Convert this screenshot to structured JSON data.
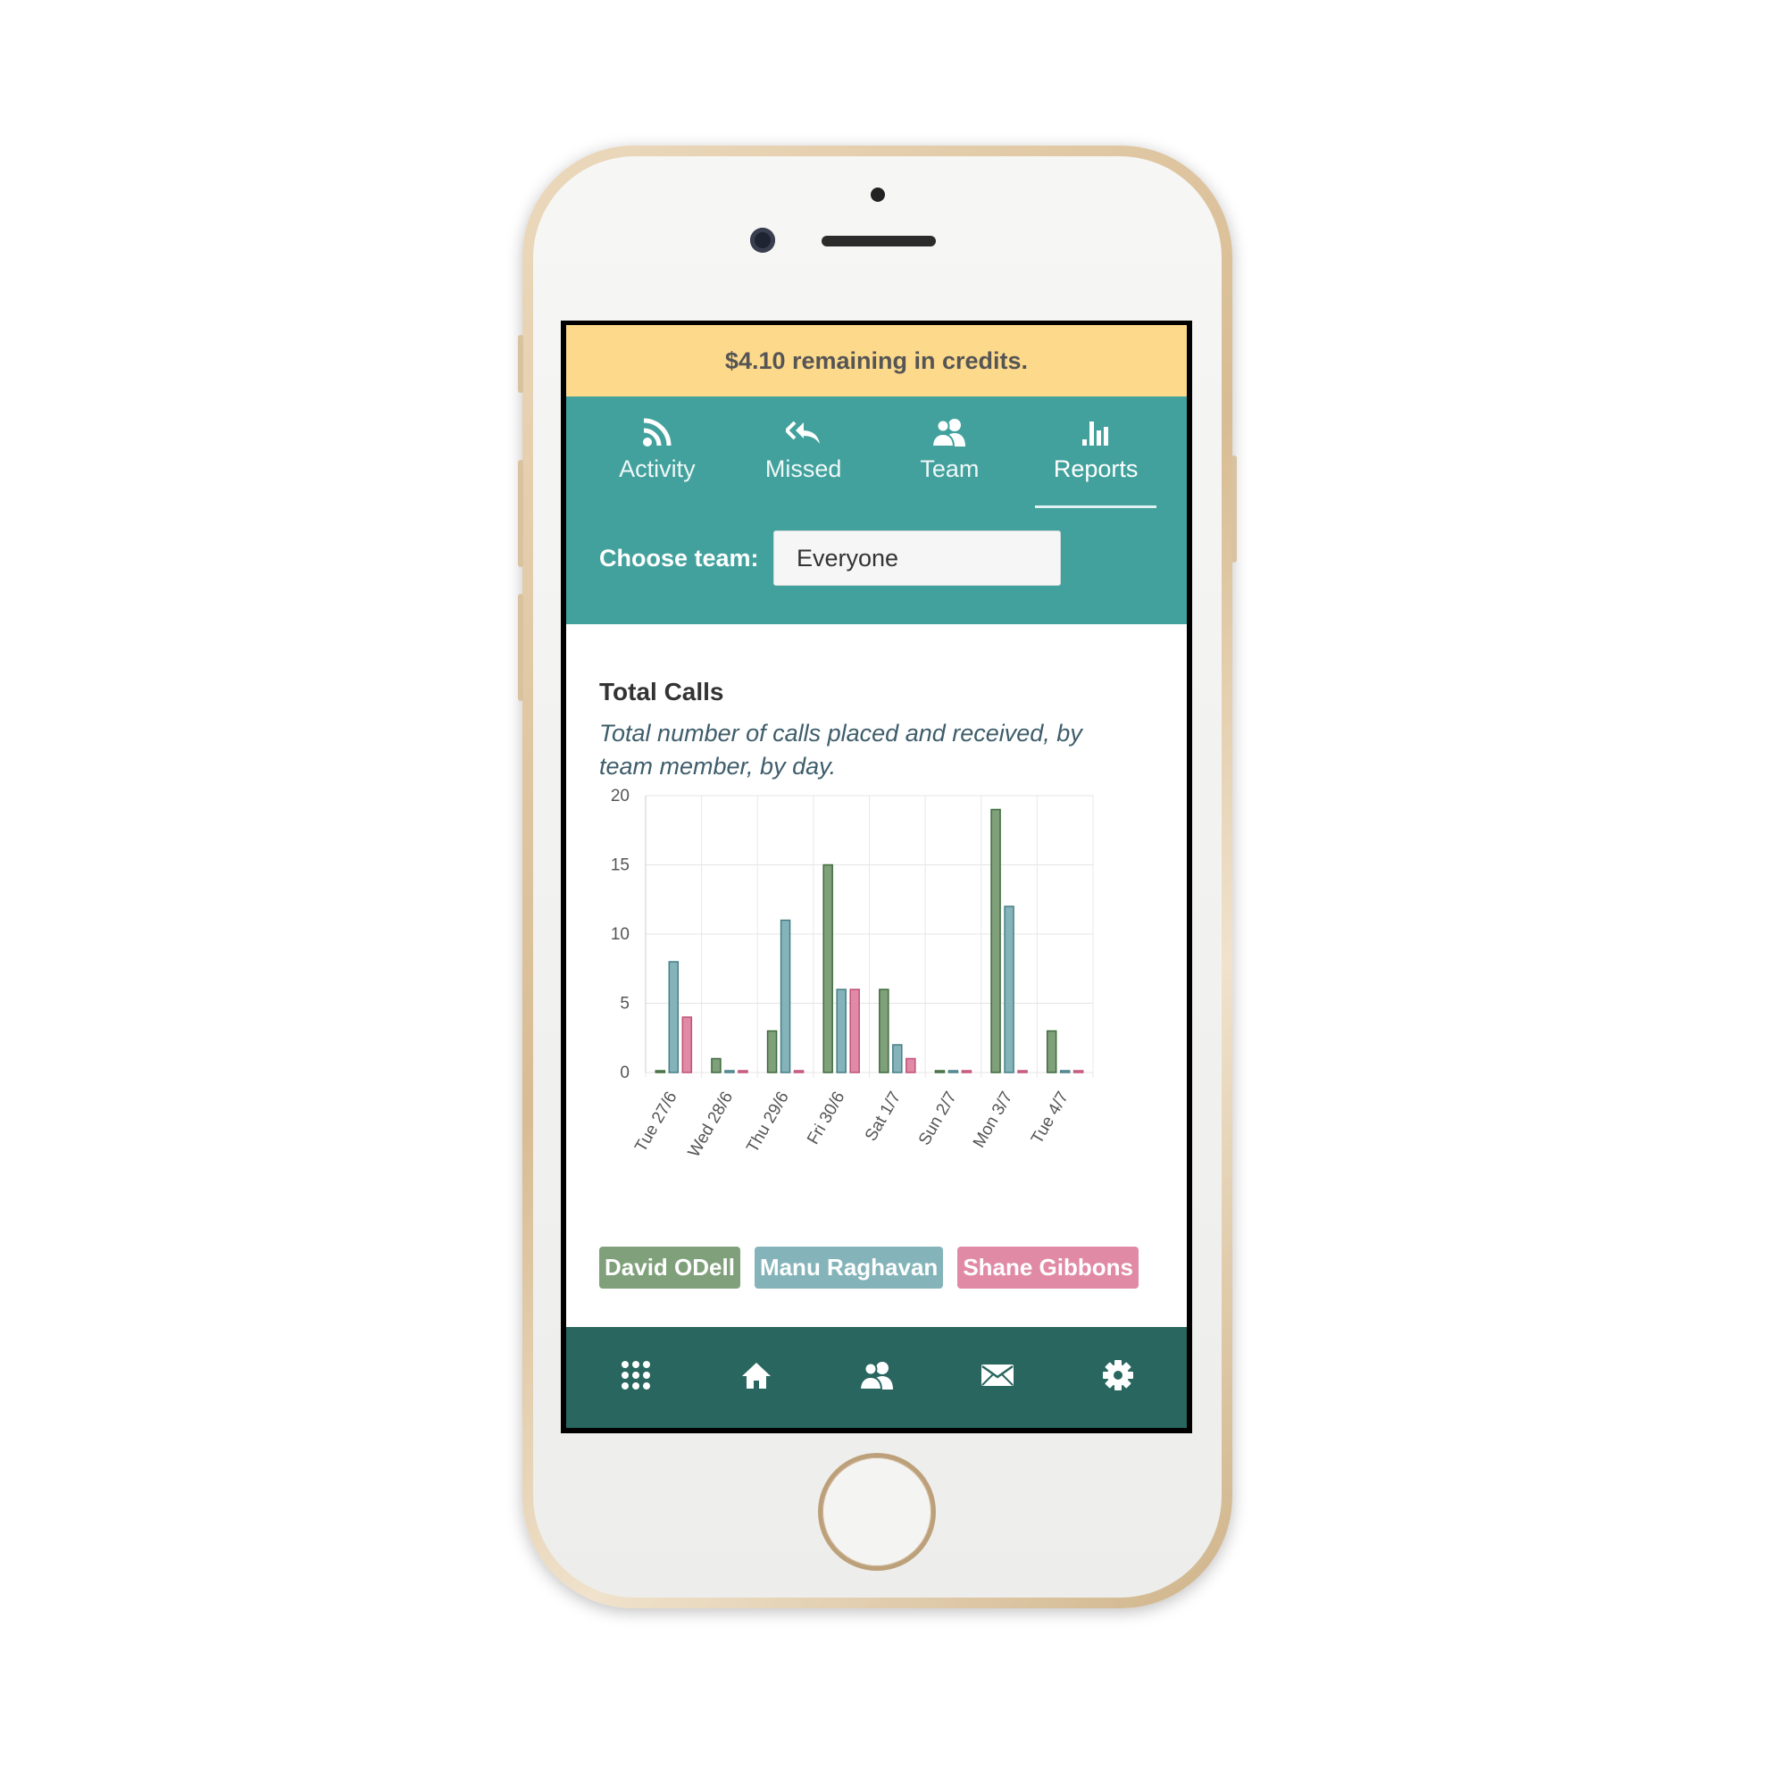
{
  "credits_banner": {
    "text": "$4.10 remaining in credits."
  },
  "tabs": [
    {
      "label": "Activity",
      "icon": "rss-icon"
    },
    {
      "label": "Missed",
      "icon": "reply-all-icon"
    },
    {
      "label": "Team",
      "icon": "users-icon"
    },
    {
      "label": "Reports",
      "icon": "bar-chart-icon",
      "active": true
    }
  ],
  "team_filter": {
    "label": "Choose team:",
    "value": "Everyone"
  },
  "report": {
    "title": "Total Calls",
    "subtitle": "Total number of calls placed and received, by team member, by day."
  },
  "bottom_nav": [
    "keypad-icon",
    "home-icon",
    "users-icon",
    "mail-icon",
    "gear-icon"
  ],
  "colors": {
    "banner": "#fdd98b",
    "header": "#42a19d",
    "bottom_nav": "#28665f",
    "david": "#7fa07a",
    "manu": "#84b4b9",
    "shane": "#e08aa6"
  },
  "chart_data": {
    "type": "bar",
    "title": "",
    "categories": [
      "Tue 27/6",
      "Wed 28/6",
      "Thu 29/6",
      "Fri 30/6",
      "Sat 1/7",
      "Sun 2/7",
      "Mon 3/7",
      "Tue 4/7"
    ],
    "series": [
      {
        "name": "David ODell",
        "values": [
          0,
          1,
          3,
          15,
          6,
          0,
          19,
          3
        ]
      },
      {
        "name": "Manu Raghavan",
        "values": [
          8,
          0,
          11,
          6,
          2,
          0,
          12,
          0
        ]
      },
      {
        "name": "Shane Gibbons",
        "values": [
          4,
          0,
          0,
          6,
          1,
          0,
          0,
          0
        ]
      }
    ],
    "yticks": [
      "0",
      "5",
      "10",
      "15",
      "20"
    ],
    "ylim": [
      0,
      20
    ],
    "grid": true,
    "legend": "bottom"
  }
}
